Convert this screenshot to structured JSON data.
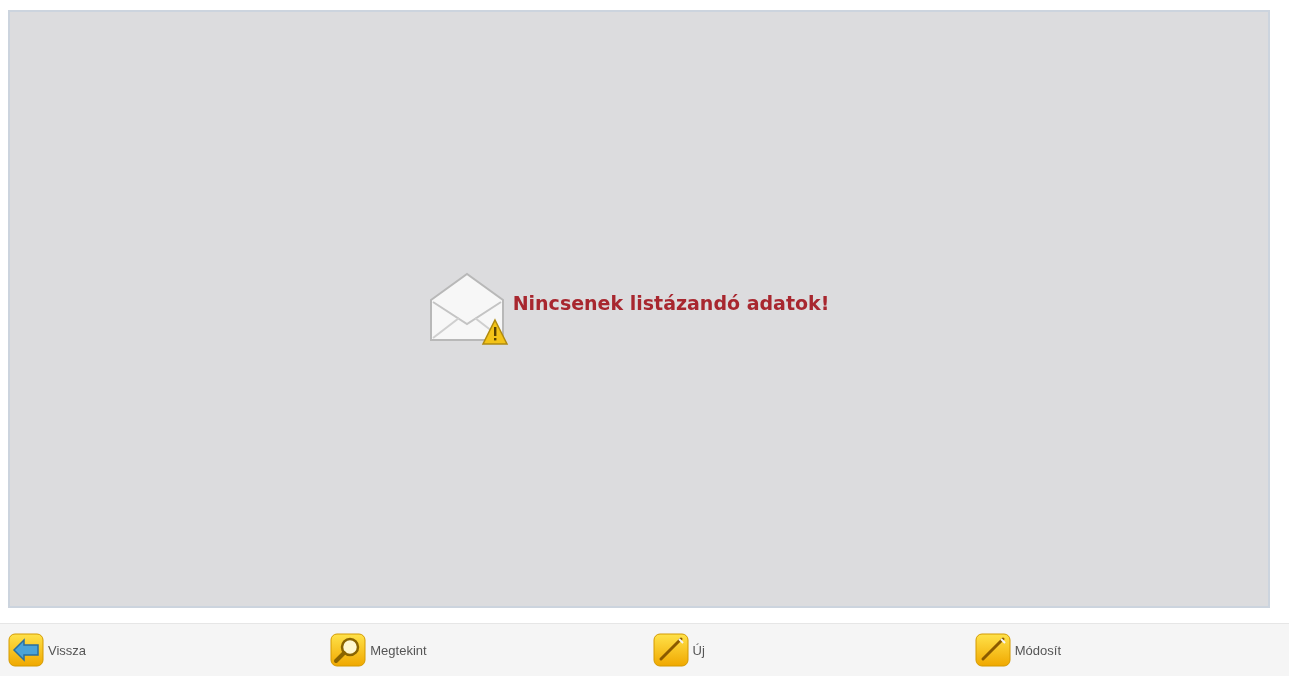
{
  "message": {
    "text": "Nincsenek listázandó adatok!"
  },
  "buttons": [
    {
      "kind": "back",
      "label": "Vissza"
    },
    {
      "kind": "view",
      "label": "Megtekint"
    },
    {
      "kind": "new",
      "label": "Új"
    },
    {
      "kind": "edit",
      "label": "Módosít"
    }
  ]
}
